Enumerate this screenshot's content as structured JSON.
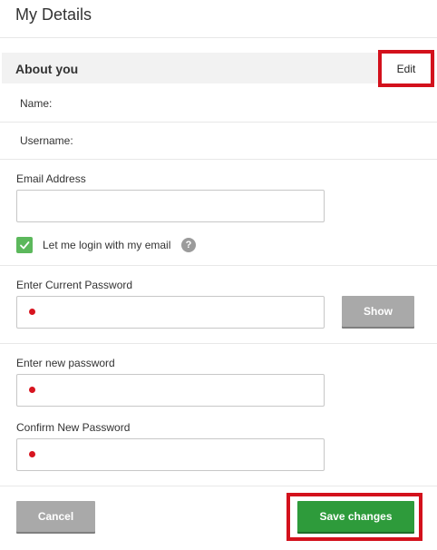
{
  "page": {
    "title": "My Details"
  },
  "section": {
    "title": "About you",
    "edit_label": "Edit"
  },
  "profile": {
    "name_label": "Name:",
    "username_label": "Username:"
  },
  "email": {
    "label": "Email Address",
    "value": "",
    "login_with_email_label": "Let me login with my email",
    "login_with_email_checked": true,
    "help_glyph": "?"
  },
  "current_password": {
    "label": "Enter Current Password",
    "show_label": "Show"
  },
  "new_password": {
    "label": "Enter new password"
  },
  "confirm_password": {
    "label": "Confirm New Password"
  },
  "actions": {
    "cancel_label": "Cancel",
    "save_label": "Save changes"
  },
  "colors": {
    "accent_green": "#2e9b3b",
    "highlight_red": "#d3111c",
    "checkbox_green": "#5cb85c",
    "button_gray": "#a9a9a9"
  }
}
